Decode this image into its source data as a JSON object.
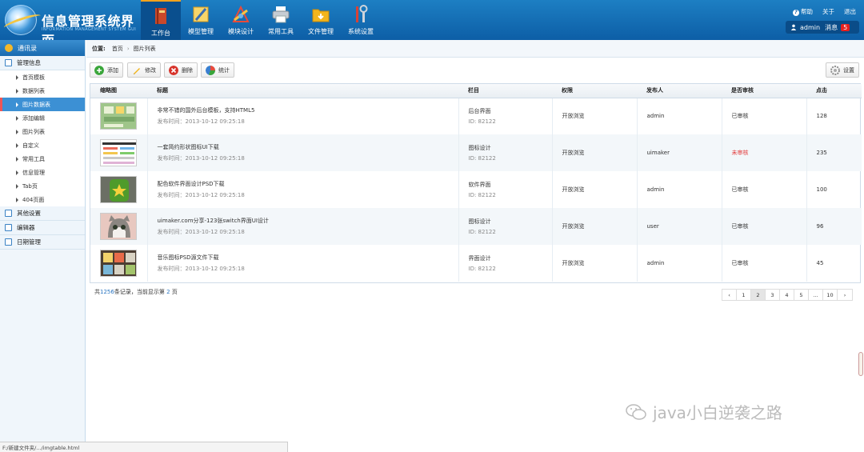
{
  "header": {
    "title": "信息管理系统界面",
    "subtitle": "INFORMATION MANAGEMENT SYSTEM GUI",
    "nav": [
      {
        "label": "工作台",
        "icon": "book-icon",
        "active": true
      },
      {
        "label": "模型管理",
        "icon": "ruler-icon",
        "active": false
      },
      {
        "label": "模块设计",
        "icon": "tools-icon",
        "active": false
      },
      {
        "label": "常用工具",
        "icon": "printer-icon",
        "active": false
      },
      {
        "label": "文件管理",
        "icon": "folder-icon",
        "active": false
      },
      {
        "label": "系统设置",
        "icon": "wrench-icon",
        "active": false
      }
    ],
    "links": {
      "help": "帮助",
      "about": "关于",
      "logout": "退出"
    },
    "user": {
      "name": "admin",
      "msg_label": "消息",
      "msg_count": "5"
    }
  },
  "sidebar": {
    "head": "通讯录",
    "sections": [
      {
        "label": "管理信息",
        "items": [
          "首页模板",
          "数据列表",
          "图片数据表",
          "添加编辑",
          "图片列表",
          "自定义",
          "常用工具",
          "信息管理",
          "Tab页",
          "404页面"
        ],
        "active_item": 2
      },
      {
        "label": "其他设置",
        "items": []
      },
      {
        "label": "编辑器",
        "items": []
      },
      {
        "label": "日期管理",
        "items": []
      }
    ]
  },
  "breadcrumb": {
    "label": "位置:",
    "items": [
      "首页",
      "图片列表"
    ]
  },
  "toolbar": {
    "add": "添加",
    "edit": "修改",
    "delete": "删除",
    "stats": "统计",
    "settings": "设置"
  },
  "table": {
    "columns": [
      "缩略图",
      "标题",
      "栏目",
      "权限",
      "发布人",
      "是否审核",
      "点击"
    ],
    "rows": [
      {
        "title": "非常不错的国外后台模板，支持HTML5",
        "time": "发布时间：2013-10-12 09:25:18",
        "column": "后台界面",
        "id": "ID: 82122",
        "perm": "开放浏览",
        "author": "admin",
        "status": "已审核",
        "clicks": "128"
      },
      {
        "title": "一套简约形状图标UI下载",
        "time": "发布时间：2013-10-12 09:25:18",
        "column": "图标设计",
        "id": "ID: 82122",
        "perm": "开放浏览",
        "author": "uimaker",
        "status": "未审核",
        "clicks": "235"
      },
      {
        "title": "配色软件界面设计PSD下载",
        "time": "发布时间：2013-10-12 09:25:18",
        "column": "软件界面",
        "id": "ID: 82122",
        "perm": "开放浏览",
        "author": "admin",
        "status": "已审核",
        "clicks": "100"
      },
      {
        "title": "uimaker.com分享-123张switch界面UI设计",
        "time": "发布时间：2013-10-12 09:25:18",
        "column": "图标设计",
        "id": "ID: 82122",
        "perm": "开放浏览",
        "author": "user",
        "status": "已审核",
        "clicks": "96"
      },
      {
        "title": "音乐图标PSD源文件下载",
        "time": "发布时间：2013-10-12 09:25:18",
        "column": "界面设计",
        "id": "ID: 82122",
        "perm": "开放浏览",
        "author": "admin",
        "status": "已审核",
        "clicks": "45"
      }
    ]
  },
  "footer": {
    "prefix": "共",
    "total": "1256",
    "mid": "条记录，当前显示第",
    "page": "2",
    "suffix": "页"
  },
  "pager": [
    "‹",
    "1",
    "2",
    "3",
    "4",
    "5",
    "...",
    "10",
    "›"
  ],
  "watermark": "java小白逆袭之路",
  "status_url": "F:/新建文件夹/.../imgtable.html",
  "colors": {
    "header": "#0d5ea6",
    "accent": "#3c90d4",
    "unreviewed": "#e23a3a"
  }
}
